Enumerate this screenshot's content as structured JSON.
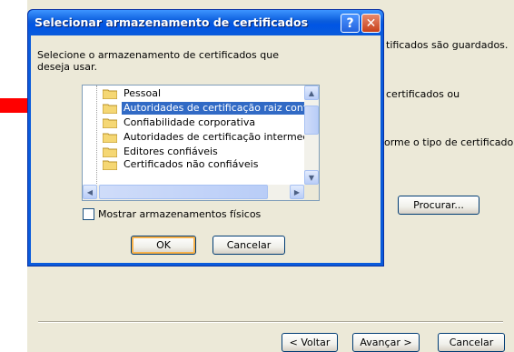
{
  "wizard": {
    "text_line1": "tificados são guardados.",
    "text_line2": "certificados ou",
    "text_line3": "orme o tipo de certificado",
    "browse_label": "Procurar...",
    "back_label": "< Voltar",
    "next_label": "Avançar >",
    "cancel_label": "Cancelar"
  },
  "dialog": {
    "title": "Selecionar armazenamento de certificados",
    "help_glyph": "?",
    "close_glyph": "✕",
    "prompt": "Selecione o armazenamento de certificados que deseja usar.",
    "stores": [
      {
        "label": "Pessoal"
      },
      {
        "label": "Autoridades de certificação raiz confiáve"
      },
      {
        "label": "Confiabilidade corporativa"
      },
      {
        "label": "Autoridades de certificação intermediária"
      },
      {
        "label": "Editores confiáveis"
      },
      {
        "label": "Certificados não confiáveis"
      }
    ],
    "selected_index": 1,
    "show_physical_label": "Mostrar armazenamentos físicos",
    "show_physical_checked": false,
    "ok_label": "OK",
    "cancel_label": "Cancelar"
  },
  "colors": {
    "titlebar": "#0A5BDB",
    "selection": "#316AC5",
    "arrow": "#FF0000"
  },
  "icons": [
    "folder-icon",
    "help-icon",
    "close-icon",
    "red-arrow-annotation"
  ]
}
